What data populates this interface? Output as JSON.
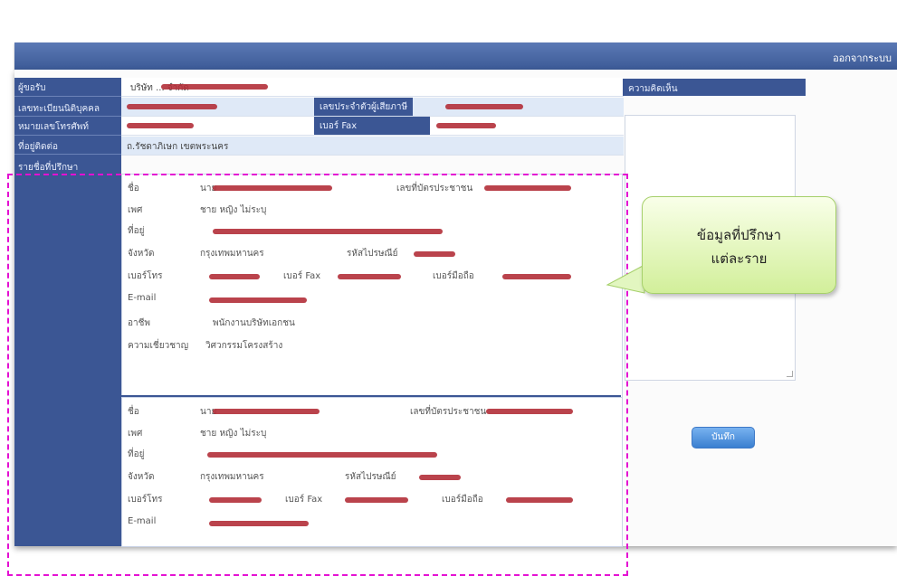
{
  "header": {
    "link_text": "ออกจากระบบ"
  },
  "sidebar": {
    "labels": [
      "ผู้ขอรับ",
      "เลขทะเบียนนิติบุคคล",
      "หมายเลขโทรศัพท์",
      "ที่อยู่ติดต่อ",
      "รายชื่อที่ปรึกษา"
    ]
  },
  "form": {
    "company_name": "บริษัท ... จำกัด",
    "phone_fax_label": "เบอร์ Fax",
    "registration_label": "เลขประจำตัวผู้เสียภาษี",
    "address_value": "ถ.รัชดาภิเษก เขตพระนคร"
  },
  "contacts": [
    {
      "rows": [
        {
          "label": "ชื่อ",
          "value": "นาย",
          "extra_label": "เลขที่บัตรประชาชน"
        },
        {
          "label": "เพศ",
          "value": "ชาย   หญิง   ไม่ระบุ"
        },
        {
          "label": "ที่อยู่",
          "value": ""
        },
        {
          "label": "จังหวัด",
          "value": "กรุงเทพมหานคร",
          "extra_label": "รหัสไปรษณีย์"
        },
        {
          "label": "เบอร์โทร",
          "value": "",
          "extra_label": "เบอร์ Fax",
          "extra_label2": "เบอร์มือถือ"
        },
        {
          "label": "E-mail",
          "value": ""
        },
        {
          "label": "อาชีพ",
          "value": "พนักงานบริษัทเอกชน"
        },
        {
          "label": "ความเชี่ยวชาญ",
          "value": "วิศวกรรมโครงสร้าง"
        }
      ]
    },
    {
      "rows": [
        {
          "label": "ชื่อ",
          "value": "นาย",
          "extra_label": "เลขที่บัตรประชาชน"
        },
        {
          "label": "เพศ",
          "value": "ชาย   หญิง   ไม่ระบุ"
        },
        {
          "label": "ที่อยู่",
          "value": ""
        },
        {
          "label": "จังหวัด",
          "value": "กรุงเทพมหานคร",
          "extra_label": "รหัสไปรษณีย์"
        },
        {
          "label": "เบอร์โทร",
          "value": "",
          "extra_label": "เบอร์ Fax",
          "extra_label2": "เบอร์มือถือ"
        },
        {
          "label": "E-mail",
          "value": ""
        }
      ]
    }
  ],
  "notes_panel": {
    "header": "ความคิดเห็น"
  },
  "save_button": {
    "label": "บันทึก"
  },
  "callout": {
    "line1": "ข้อมูลที่ปรึกษา",
    "line2": "แต่ละราย"
  },
  "colors": {
    "primary": "#3b5694",
    "highlight": "#dfe9f7",
    "redaction": "#b22f38",
    "annotation": "#e40fd2",
    "callout": "#d2ef9a"
  }
}
